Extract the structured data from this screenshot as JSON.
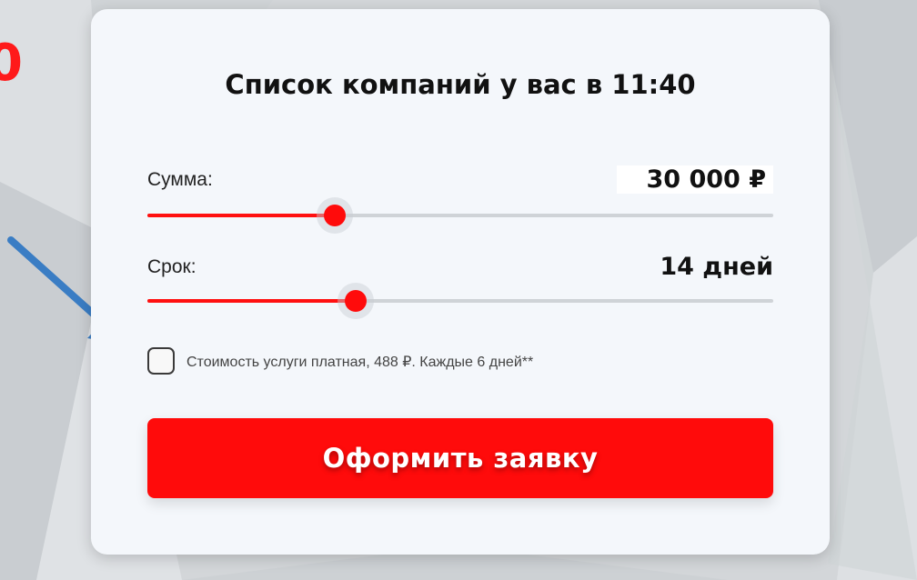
{
  "background": {
    "edge_text": "0",
    "colors": {
      "base": "#d3d6d9",
      "arrow": "#3a7dc4",
      "accent": "#ff0b0b"
    }
  },
  "card": {
    "title": "Список компаний у вас в 11:40",
    "amount": {
      "label": "Сумма:",
      "value": "30 000 ₽",
      "slider_fraction": 0.3
    },
    "term": {
      "label": "Срок:",
      "value": "14 дней",
      "slider_fraction": 0.333
    },
    "consent": {
      "checked": false,
      "text": "Стоимость услуги платная, 488 ₽. Каждые 6 дней**"
    },
    "submit_label": "Оформить заявку"
  }
}
